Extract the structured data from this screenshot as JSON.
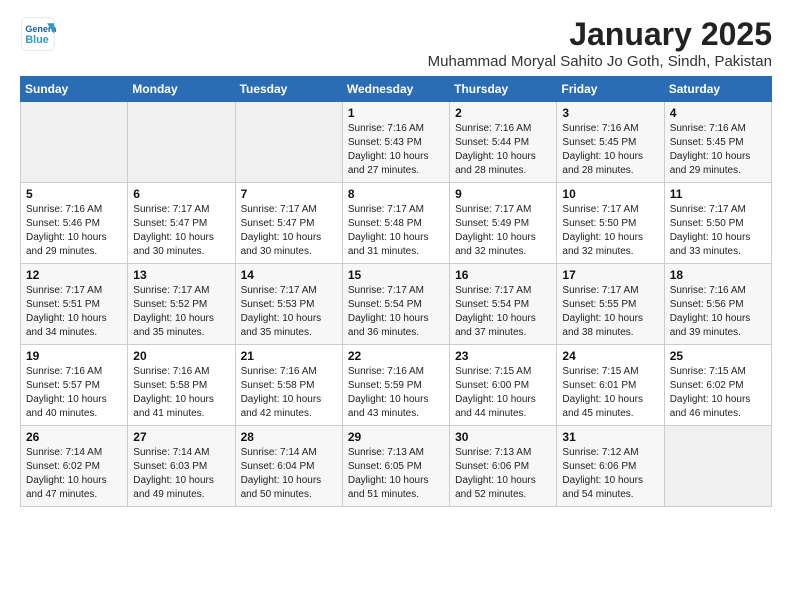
{
  "header": {
    "logo_line1": "General",
    "logo_line2": "Blue",
    "title": "January 2025",
    "subtitle": "Muhammad Moryal Sahito Jo Goth, Sindh, Pakistan"
  },
  "days_of_week": [
    "Sunday",
    "Monday",
    "Tuesday",
    "Wednesday",
    "Thursday",
    "Friday",
    "Saturday"
  ],
  "weeks": [
    [
      {
        "day": "",
        "sunrise": "",
        "sunset": "",
        "daylight": ""
      },
      {
        "day": "",
        "sunrise": "",
        "sunset": "",
        "daylight": ""
      },
      {
        "day": "",
        "sunrise": "",
        "sunset": "",
        "daylight": ""
      },
      {
        "day": "1",
        "sunrise": "Sunrise: 7:16 AM",
        "sunset": "Sunset: 5:43 PM",
        "daylight": "Daylight: 10 hours and 27 minutes."
      },
      {
        "day": "2",
        "sunrise": "Sunrise: 7:16 AM",
        "sunset": "Sunset: 5:44 PM",
        "daylight": "Daylight: 10 hours and 28 minutes."
      },
      {
        "day": "3",
        "sunrise": "Sunrise: 7:16 AM",
        "sunset": "Sunset: 5:45 PM",
        "daylight": "Daylight: 10 hours and 28 minutes."
      },
      {
        "day": "4",
        "sunrise": "Sunrise: 7:16 AM",
        "sunset": "Sunset: 5:45 PM",
        "daylight": "Daylight: 10 hours and 29 minutes."
      }
    ],
    [
      {
        "day": "5",
        "sunrise": "Sunrise: 7:16 AM",
        "sunset": "Sunset: 5:46 PM",
        "daylight": "Daylight: 10 hours and 29 minutes."
      },
      {
        "day": "6",
        "sunrise": "Sunrise: 7:17 AM",
        "sunset": "Sunset: 5:47 PM",
        "daylight": "Daylight: 10 hours and 30 minutes."
      },
      {
        "day": "7",
        "sunrise": "Sunrise: 7:17 AM",
        "sunset": "Sunset: 5:47 PM",
        "daylight": "Daylight: 10 hours and 30 minutes."
      },
      {
        "day": "8",
        "sunrise": "Sunrise: 7:17 AM",
        "sunset": "Sunset: 5:48 PM",
        "daylight": "Daylight: 10 hours and 31 minutes."
      },
      {
        "day": "9",
        "sunrise": "Sunrise: 7:17 AM",
        "sunset": "Sunset: 5:49 PM",
        "daylight": "Daylight: 10 hours and 32 minutes."
      },
      {
        "day": "10",
        "sunrise": "Sunrise: 7:17 AM",
        "sunset": "Sunset: 5:50 PM",
        "daylight": "Daylight: 10 hours and 32 minutes."
      },
      {
        "day": "11",
        "sunrise": "Sunrise: 7:17 AM",
        "sunset": "Sunset: 5:50 PM",
        "daylight": "Daylight: 10 hours and 33 minutes."
      }
    ],
    [
      {
        "day": "12",
        "sunrise": "Sunrise: 7:17 AM",
        "sunset": "Sunset: 5:51 PM",
        "daylight": "Daylight: 10 hours and 34 minutes."
      },
      {
        "day": "13",
        "sunrise": "Sunrise: 7:17 AM",
        "sunset": "Sunset: 5:52 PM",
        "daylight": "Daylight: 10 hours and 35 minutes."
      },
      {
        "day": "14",
        "sunrise": "Sunrise: 7:17 AM",
        "sunset": "Sunset: 5:53 PM",
        "daylight": "Daylight: 10 hours and 35 minutes."
      },
      {
        "day": "15",
        "sunrise": "Sunrise: 7:17 AM",
        "sunset": "Sunset: 5:54 PM",
        "daylight": "Daylight: 10 hours and 36 minutes."
      },
      {
        "day": "16",
        "sunrise": "Sunrise: 7:17 AM",
        "sunset": "Sunset: 5:54 PM",
        "daylight": "Daylight: 10 hours and 37 minutes."
      },
      {
        "day": "17",
        "sunrise": "Sunrise: 7:17 AM",
        "sunset": "Sunset: 5:55 PM",
        "daylight": "Daylight: 10 hours and 38 minutes."
      },
      {
        "day": "18",
        "sunrise": "Sunrise: 7:16 AM",
        "sunset": "Sunset: 5:56 PM",
        "daylight": "Daylight: 10 hours and 39 minutes."
      }
    ],
    [
      {
        "day": "19",
        "sunrise": "Sunrise: 7:16 AM",
        "sunset": "Sunset: 5:57 PM",
        "daylight": "Daylight: 10 hours and 40 minutes."
      },
      {
        "day": "20",
        "sunrise": "Sunrise: 7:16 AM",
        "sunset": "Sunset: 5:58 PM",
        "daylight": "Daylight: 10 hours and 41 minutes."
      },
      {
        "day": "21",
        "sunrise": "Sunrise: 7:16 AM",
        "sunset": "Sunset: 5:58 PM",
        "daylight": "Daylight: 10 hours and 42 minutes."
      },
      {
        "day": "22",
        "sunrise": "Sunrise: 7:16 AM",
        "sunset": "Sunset: 5:59 PM",
        "daylight": "Daylight: 10 hours and 43 minutes."
      },
      {
        "day": "23",
        "sunrise": "Sunrise: 7:15 AM",
        "sunset": "Sunset: 6:00 PM",
        "daylight": "Daylight: 10 hours and 44 minutes."
      },
      {
        "day": "24",
        "sunrise": "Sunrise: 7:15 AM",
        "sunset": "Sunset: 6:01 PM",
        "daylight": "Daylight: 10 hours and 45 minutes."
      },
      {
        "day": "25",
        "sunrise": "Sunrise: 7:15 AM",
        "sunset": "Sunset: 6:02 PM",
        "daylight": "Daylight: 10 hours and 46 minutes."
      }
    ],
    [
      {
        "day": "26",
        "sunrise": "Sunrise: 7:14 AM",
        "sunset": "Sunset: 6:02 PM",
        "daylight": "Daylight: 10 hours and 47 minutes."
      },
      {
        "day": "27",
        "sunrise": "Sunrise: 7:14 AM",
        "sunset": "Sunset: 6:03 PM",
        "daylight": "Daylight: 10 hours and 49 minutes."
      },
      {
        "day": "28",
        "sunrise": "Sunrise: 7:14 AM",
        "sunset": "Sunset: 6:04 PM",
        "daylight": "Daylight: 10 hours and 50 minutes."
      },
      {
        "day": "29",
        "sunrise": "Sunrise: 7:13 AM",
        "sunset": "Sunset: 6:05 PM",
        "daylight": "Daylight: 10 hours and 51 minutes."
      },
      {
        "day": "30",
        "sunrise": "Sunrise: 7:13 AM",
        "sunset": "Sunset: 6:06 PM",
        "daylight": "Daylight: 10 hours and 52 minutes."
      },
      {
        "day": "31",
        "sunrise": "Sunrise: 7:12 AM",
        "sunset": "Sunset: 6:06 PM",
        "daylight": "Daylight: 10 hours and 54 minutes."
      },
      {
        "day": "",
        "sunrise": "",
        "sunset": "",
        "daylight": ""
      }
    ]
  ]
}
